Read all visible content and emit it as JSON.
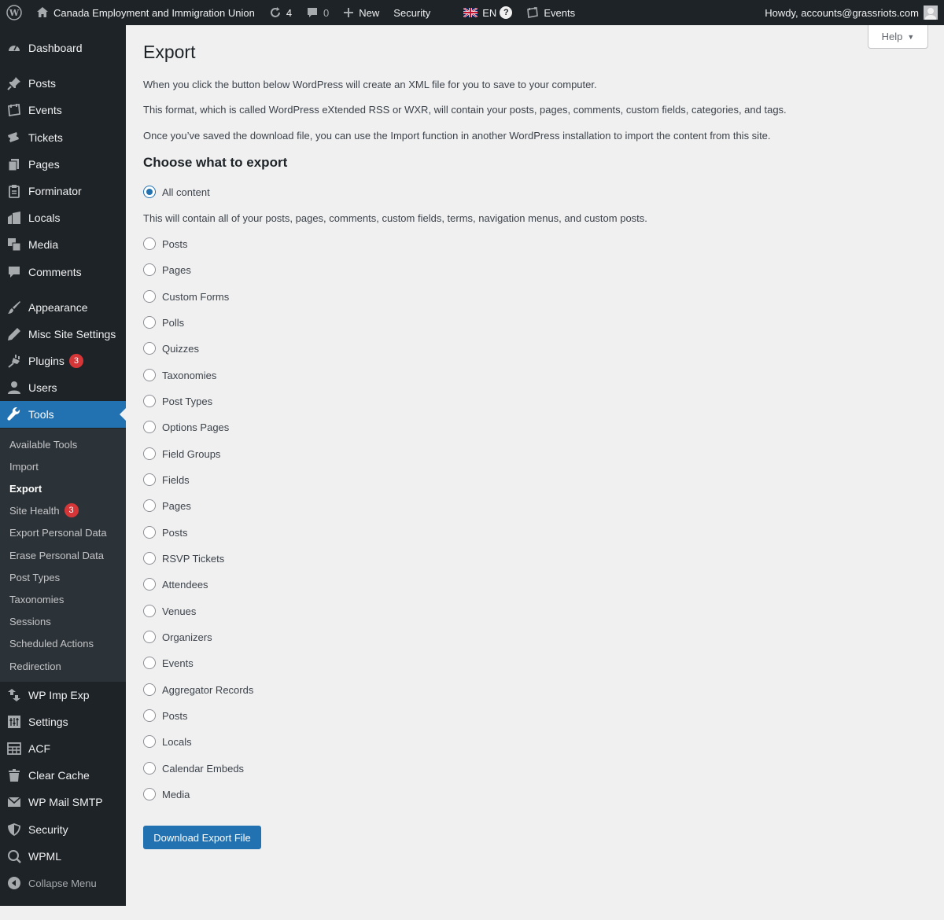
{
  "adminbar": {
    "site_name": "Canada Employment and Immigration Union",
    "updates_count": "4",
    "comments_count": "0",
    "new_label": "New",
    "security_label": "Security",
    "lang_label": "EN",
    "events_label": "Events",
    "howdy": "Howdy, accounts@grassriots.com"
  },
  "sidebar": {
    "items": [
      {
        "label": "Dashboard",
        "icon": "dashboard-icon"
      },
      {
        "label": "Posts",
        "icon": "pin-icon"
      },
      {
        "label": "Events",
        "icon": "calendar-icon"
      },
      {
        "label": "Tickets",
        "icon": "ticket-icon"
      },
      {
        "label": "Pages",
        "icon": "pages-icon"
      },
      {
        "label": "Forminator",
        "icon": "clipboard-icon"
      },
      {
        "label": "Locals",
        "icon": "building-icon"
      },
      {
        "label": "Media",
        "icon": "media-icon"
      },
      {
        "label": "Comments",
        "icon": "comment-icon"
      },
      {
        "label": "Appearance",
        "icon": "brush-icon"
      },
      {
        "label": "Misc Site Settings",
        "icon": "pencil-icon"
      },
      {
        "label": "Plugins",
        "icon": "plug-icon",
        "badge": "3"
      },
      {
        "label": "Users",
        "icon": "user-icon"
      },
      {
        "label": "Tools",
        "icon": "wrench-icon"
      },
      {
        "label": "WP Imp Exp",
        "icon": "transfer-icon"
      },
      {
        "label": "Settings",
        "icon": "settings-icon"
      },
      {
        "label": "ACF",
        "icon": "grid-icon"
      },
      {
        "label": "Clear Cache",
        "icon": "trash-icon"
      },
      {
        "label": "WP Mail SMTP",
        "icon": "mail-icon"
      },
      {
        "label": "Security",
        "icon": "shield-icon"
      },
      {
        "label": "WPML",
        "icon": "wpml-icon"
      }
    ],
    "submenu": [
      {
        "label": "Available Tools"
      },
      {
        "label": "Import"
      },
      {
        "label": "Export"
      },
      {
        "label": "Site Health",
        "badge": "3"
      },
      {
        "label": "Export Personal Data"
      },
      {
        "label": "Erase Personal Data"
      },
      {
        "label": "Post Types"
      },
      {
        "label": "Taxonomies"
      },
      {
        "label": "Sessions"
      },
      {
        "label": "Scheduled Actions"
      },
      {
        "label": "Redirection"
      }
    ],
    "collapse_label": "Collapse Menu"
  },
  "help_label": "Help",
  "page": {
    "title": "Export",
    "para1": "When you click the button below WordPress will create an XML file for you to save to your computer.",
    "para2": "This format, which is called WordPress eXtended RSS or WXR, will contain your posts, pages, comments, custom fields, categories, and tags.",
    "para3": "Once you’ve saved the download file, you can use the Import function in another WordPress installation to import the content from this site.",
    "section_title": "Choose what to export",
    "all_content_label": "All content",
    "all_content_desc": "This will contain all of your posts, pages, comments, custom fields, terms, navigation menus, and custom posts.",
    "options": [
      "Posts",
      "Pages",
      "Custom Forms",
      "Polls",
      "Quizzes",
      "Taxonomies",
      "Post Types",
      "Options Pages",
      "Field Groups",
      "Fields",
      "Pages",
      "Posts",
      "RSVP Tickets",
      "Attendees",
      "Venues",
      "Organizers",
      "Events",
      "Aggregator Records",
      "Posts",
      "Locals",
      "Calendar Embeds",
      "Media"
    ],
    "download_label": "Download Export File"
  },
  "colors": {
    "accent": "#2271b1",
    "sidebar_bg": "#1d2327",
    "submenu_bg": "#2c3338",
    "badge": "#d63638"
  }
}
